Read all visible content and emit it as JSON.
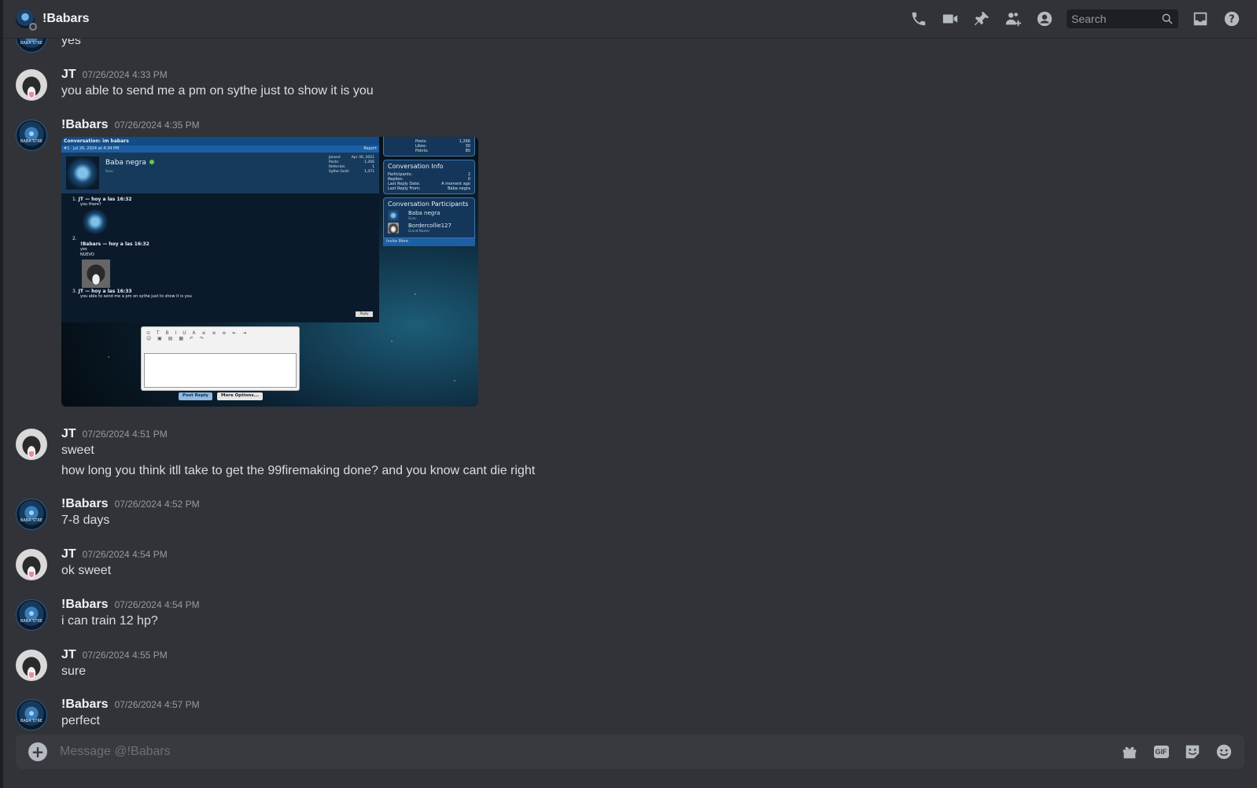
{
  "header": {
    "title": "!Babars",
    "search_placeholder": "Search",
    "icons": [
      "call-icon",
      "video-icon",
      "pin-icon",
      "add-friends-icon",
      "profile-icon",
      "search-icon",
      "inbox-icon",
      "help-icon"
    ]
  },
  "messages": [
    {
      "author": "",
      "time": "",
      "lines": [
        "yes"
      ]
    },
    {
      "author": "JT",
      "time": "07/26/2024 4:33 PM",
      "lines": [
        "you able to send me a pm on sythe just to show it is you"
      ]
    },
    {
      "author": "!Babars",
      "time": "07/26/2024 4:35 PM",
      "lines": []
    },
    {
      "author": "JT",
      "time": "07/26/2024 4:51 PM",
      "lines": [
        "sweet",
        "how long you think itll take to get the 99firemaking done? and you know cant die right"
      ]
    },
    {
      "author": "!Babars",
      "time": "07/26/2024 4:52 PM",
      "lines": [
        "7-8 days"
      ]
    },
    {
      "author": "JT",
      "time": "07/26/2024 4:54 PM",
      "lines": [
        "ok sweet"
      ]
    },
    {
      "author": "!Babars",
      "time": "07/26/2024 4:54 PM",
      "lines": [
        "i can train 12 hp?"
      ]
    },
    {
      "author": "JT",
      "time": "07/26/2024 4:55 PM",
      "lines": [
        "sure"
      ]
    },
    {
      "author": "!Babars",
      "time": "07/26/2024 4:57 PM",
      "lines": [
        "perfect"
      ]
    }
  ],
  "attachment": {
    "conv_title": "Conversation: im babars",
    "post_ref": "#1 · Jul 26, 2024 at 4:34 PM",
    "report": "Report",
    "poster_name": "Baba negra",
    "poster_role": "Guru",
    "stats": [
      [
        "Joined:",
        "Apr 30, 2021"
      ],
      [
        "Posts:",
        "1,266"
      ],
      [
        "Referrals:",
        "1"
      ],
      [
        "Sythe Gold:",
        "1,471"
      ]
    ],
    "side_stats": [
      [
        "Posts:",
        "1,266"
      ],
      [
        "Likes:",
        "30"
      ],
      [
        "Points:",
        "80"
      ]
    ],
    "entries": [
      {
        "n": "1.",
        "head": "JT — hoy a las 16:32",
        "body": [
          "you there?"
        ]
      },
      {
        "n": "2.",
        "head": "!Babars — hoy a las 16:32",
        "body": [
          "yes",
          "NUEVO"
        ]
      },
      {
        "n": "3.",
        "head": "JT — hoy a las 16:33",
        "body": [
          "you able to send me a pm on sythe just to show it is you"
        ]
      }
    ],
    "reply_small": "Reply",
    "info_title": "Conversation Info",
    "info_rows": [
      [
        "Participants:",
        "2"
      ],
      [
        "Replies:",
        "0"
      ],
      [
        "Last Reply Date:",
        "A moment ago"
      ],
      [
        "Last Reply From:",
        "Baba negra"
      ]
    ],
    "participants_title": "Conversation Participants",
    "participants": [
      {
        "name": "Baba negra",
        "role": "Guru"
      },
      {
        "name": "Bordercollie127",
        "role": "Grand Master"
      }
    ],
    "invite": "Invite More",
    "post_reply": "Post Reply",
    "more_options": "More Options..."
  },
  "composer": {
    "placeholder": "Message @!Babars",
    "icons": [
      "gift-icon",
      "gif-icon",
      "sticker-icon",
      "emoji-icon"
    ],
    "gif_label": "GIF"
  }
}
